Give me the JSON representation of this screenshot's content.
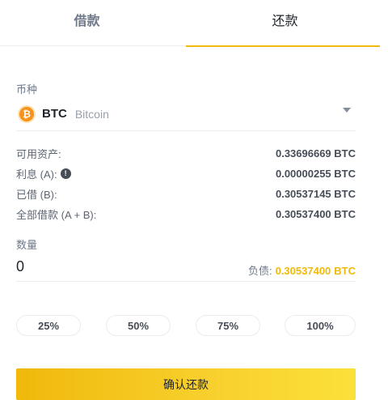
{
  "tabs": {
    "borrow": "借款",
    "repay": "还款",
    "active": "repay"
  },
  "coin_section": {
    "label": "币种",
    "symbol": "BTC",
    "name": "Bitcoin",
    "icon": "bitcoin-icon",
    "icon_glyph": "₿",
    "brand_color": "#f7931a"
  },
  "info": {
    "available_label": "可用资产:",
    "available_value": "0.33696669 BTC",
    "interest_label": "利息 (A):",
    "interest_value": "0.00000255 BTC",
    "borrowed_label": "已借 (B):",
    "borrowed_value": "0.30537145 BTC",
    "total_label": "全部借款 (A + B):",
    "total_value": "0.30537400 BTC"
  },
  "quantity": {
    "label": "数量",
    "value": "0",
    "debt_label": "负债:",
    "debt_amount": "0.30537400",
    "debt_unit": "BTC"
  },
  "percent_buttons": [
    "25%",
    "50%",
    "75%",
    "100%"
  ],
  "confirm_label": "确认还款",
  "colors": {
    "accent": "#f0b90b",
    "text": "#1e2329",
    "muted": "#707a8a"
  }
}
